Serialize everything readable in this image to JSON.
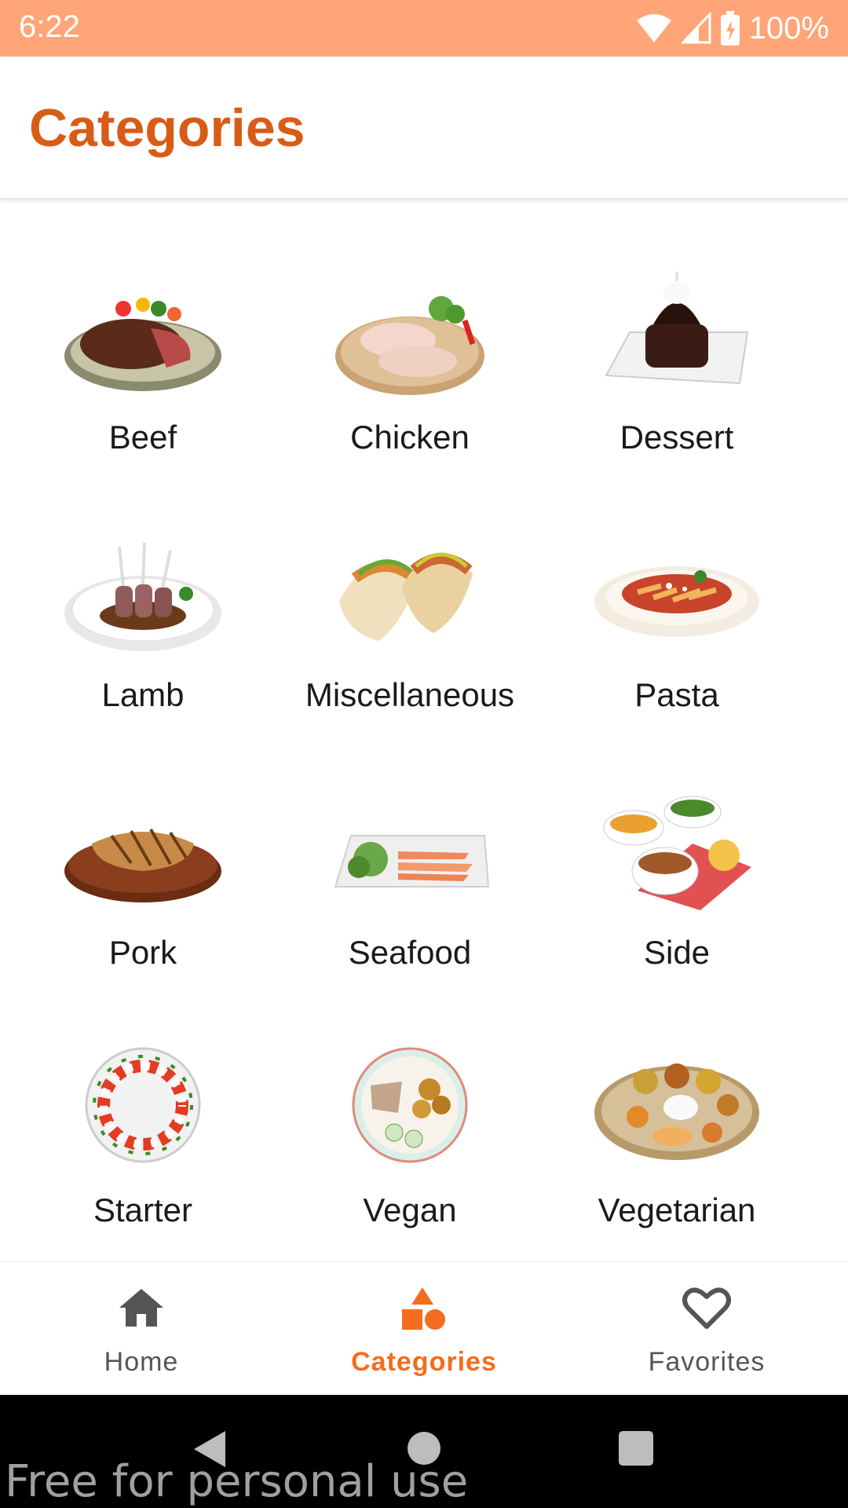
{
  "status": {
    "time": "6:22",
    "battery": "100%"
  },
  "app_bar": {
    "title": "Categories"
  },
  "categories": [
    {
      "label": "Beef",
      "icon": "beef-steak-image"
    },
    {
      "label": "Chicken",
      "icon": "chicken-legs-image"
    },
    {
      "label": "Dessert",
      "icon": "chocolate-cake-image"
    },
    {
      "label": "Lamb",
      "icon": "lamb-chops-image"
    },
    {
      "label": "Miscellaneous",
      "icon": "tacos-image"
    },
    {
      "label": "Pasta",
      "icon": "pasta-bowl-image"
    },
    {
      "label": "Pork",
      "icon": "pork-chop-image"
    },
    {
      "label": "Seafood",
      "icon": "salmon-plate-image"
    },
    {
      "label": "Side",
      "icon": "side-dishes-image"
    },
    {
      "label": "Starter",
      "icon": "caprese-wreath-image"
    },
    {
      "label": "Vegan",
      "icon": "vegan-bowl-image"
    },
    {
      "label": "Vegetarian",
      "icon": "thali-platter-image"
    }
  ],
  "bottom_nav": {
    "home": "Home",
    "categories": "Categories",
    "favorites": "Favorites",
    "active": "categories"
  },
  "watermark": "Free for personal use",
  "colors": {
    "status_bar": "#ffa577",
    "accent": "#f26d1f",
    "title": "#d95c16"
  }
}
